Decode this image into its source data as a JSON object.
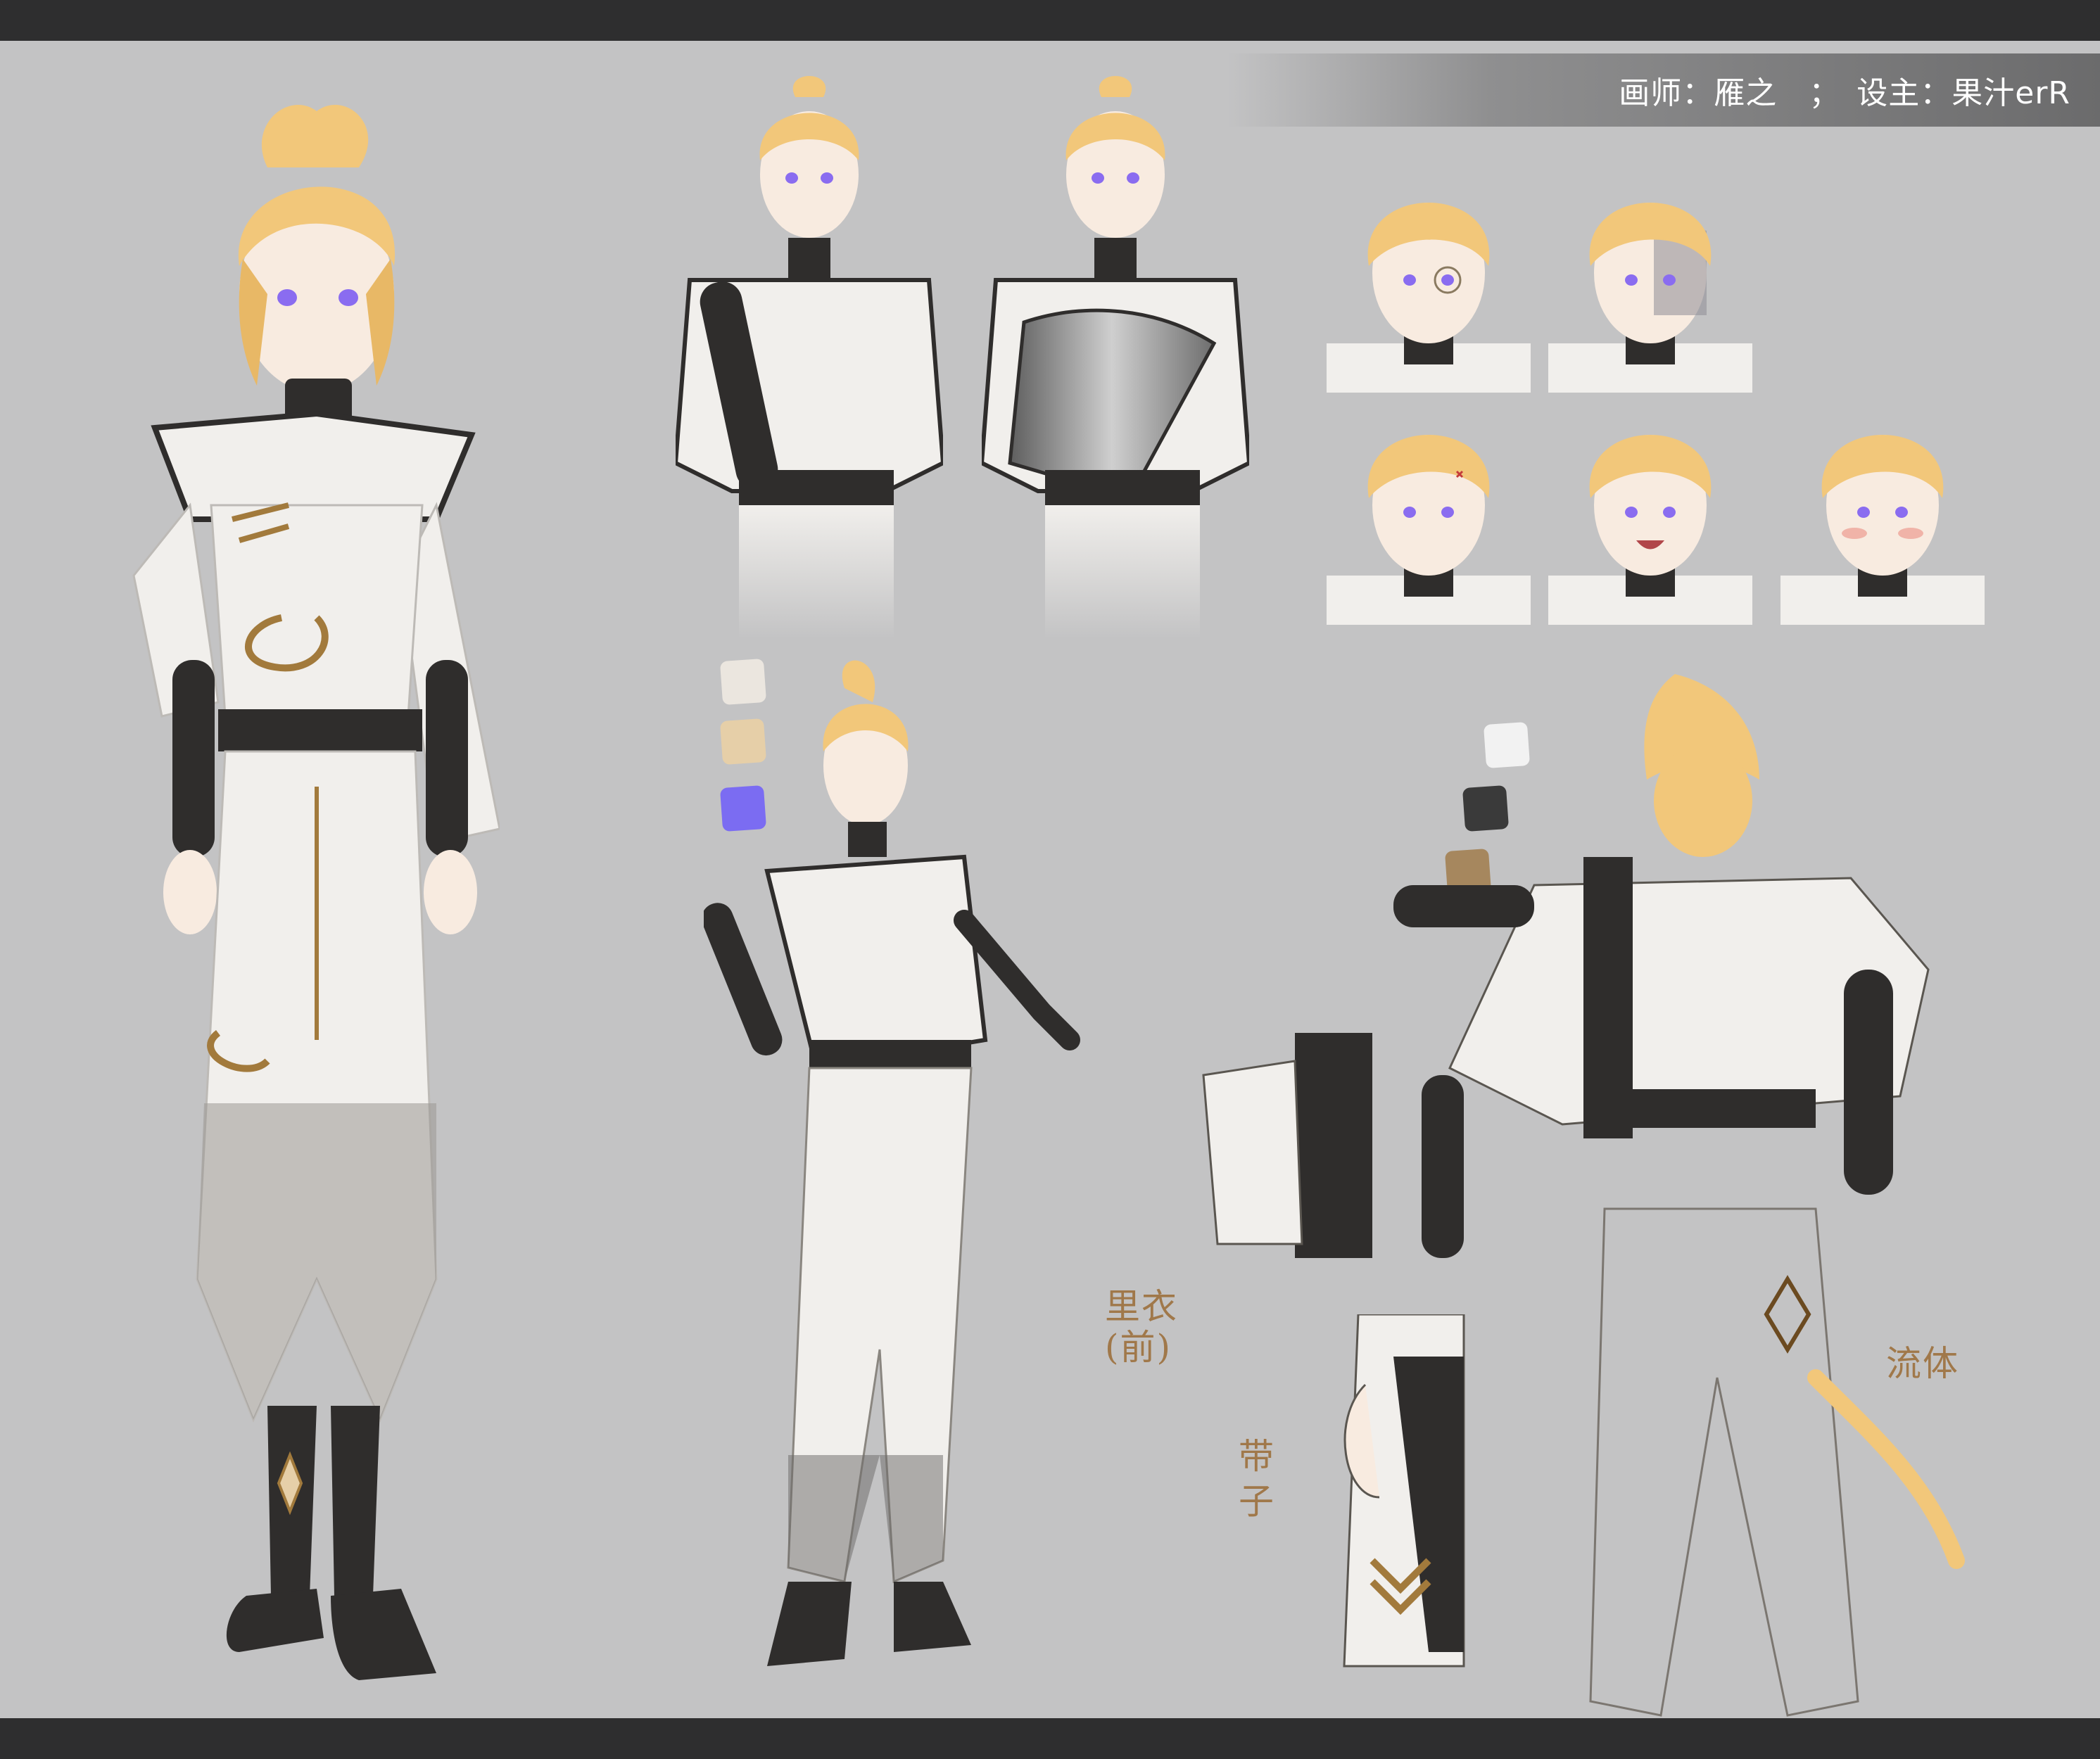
{
  "credit": {
    "text": "画师：雁之　；　设主：果汁erR"
  },
  "annotations": {
    "inner_garment_line1": "里衣",
    "inner_garment_line2": "(前)",
    "belt_line1": "带",
    "belt_line2": "子",
    "flow": "流体"
  },
  "palette": {
    "front_swatches": [
      "#ebe6df",
      "#e6cfa8",
      "#7b6cf2"
    ],
    "back_swatches": [
      "#f2f2f2",
      "#3a3a3a",
      "#a6875e"
    ]
  },
  "colors": {
    "hair": "#f2c77a",
    "hair_shadow": "#d9a556",
    "skin": "#f8ebe0",
    "robe": "#f1efec",
    "dark": "#2f2d2c",
    "gold": "#a27a3c",
    "eye": "#8a6cf0"
  }
}
